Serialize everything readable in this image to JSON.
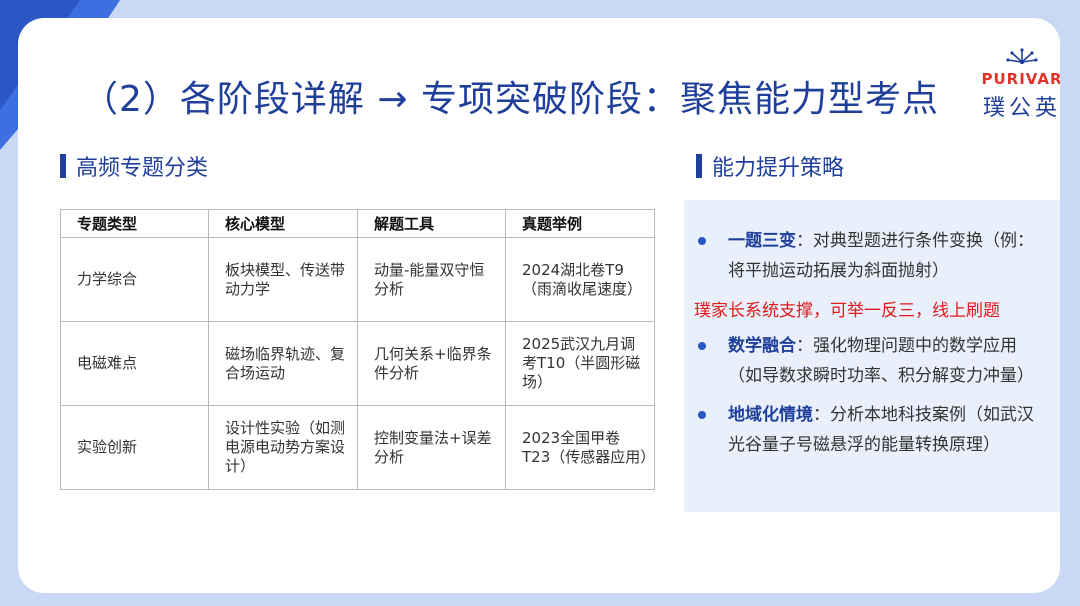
{
  "slide": {
    "title": "（2）各阶段详解 → 专项突破阶段：聚焦能力型考点"
  },
  "logo": {
    "en": "PURIVAR",
    "cn": "璞公英"
  },
  "sections": {
    "left_title": "高频专题分类",
    "right_title": "能力提升策略"
  },
  "table": {
    "headers": [
      "专题类型",
      "核心模型",
      "解题工具",
      "真题举例"
    ],
    "rows": [
      [
        "力学综合",
        "板块模型、传送带动力学",
        "动量-能量双守恒分析",
        "2024湖北卷T9（雨滴收尾速度）"
      ],
      [
        "电磁难点",
        "磁场临界轨迹、复合场运动",
        "几何关系+临界条件分析",
        "2025武汉九月调考T10（半圆形磁场）"
      ],
      [
        "实验创新",
        "设计性实验（如测电源电动势方案设计）",
        "控制变量法+误差分析",
        "2023全国甲卷T23（传感器应用）"
      ]
    ]
  },
  "strategies": [
    {
      "keyword": "一题三变",
      "text": "：对典型题进行条件变换（例：将平抛运动拓展为斜面抛射）"
    },
    {
      "keyword": "数学融合",
      "text": "：强化物理问题中的数学应用（如导数求瞬时功率、积分解变力冲量）"
    },
    {
      "keyword": "地域化情境",
      "text": "：分析本地科技案例（如武汉光谷量子号磁悬浮的能量转换原理）"
    }
  ],
  "promo": "璞家长系统支撑，可举一反三，线上刷题",
  "colors": {
    "primary": "#1f3f9a",
    "accent_red": "#e01919",
    "panel_bg": "#e9f0fb",
    "frame_bg": "#c9d8f4"
  }
}
